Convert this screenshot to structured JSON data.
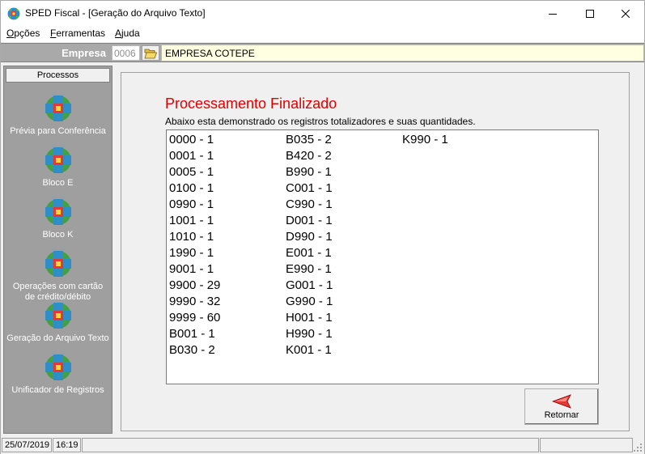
{
  "window": {
    "title": "SPED Fiscal - [Geração do Arquivo Texto]"
  },
  "menu": {
    "items": [
      {
        "label": "Opções",
        "key": "O",
        "rest": "pções"
      },
      {
        "label": "Ferramentas",
        "key": "F",
        "rest": "erramentas"
      },
      {
        "label": "Ajuda",
        "key": "A",
        "rest": "juda"
      }
    ]
  },
  "empresa": {
    "label": "Empresa",
    "code": "0006",
    "name": "EMPRESA COTEPE"
  },
  "sidebar": {
    "header": "Processos",
    "items": [
      {
        "label": "Prévia para Conferência",
        "icon": "globe-icon"
      },
      {
        "label": "Bloco E",
        "icon": "globe-icon"
      },
      {
        "label": "Bloco K",
        "icon": "globe-icon"
      },
      {
        "label": "Operações com cartão de crédito/débito",
        "icon": "globe-icon"
      },
      {
        "label": "Geração do Arquivo Texto",
        "icon": "globe-icon"
      },
      {
        "label": "Unificador de Registros",
        "icon": "globe-icon"
      }
    ]
  },
  "main": {
    "title": "Processamento Finalizado",
    "subtitle": "Abaixo esta demonstrado os registros totalizadores e suas quantidades.",
    "columns": [
      [
        "0000 - 1",
        "0001 - 1",
        "0005 - 1",
        "0100 - 1",
        "0990 - 1",
        "1001 - 1",
        "1010 - 1",
        "1990 - 1",
        "9001 - 1",
        "9900 - 29",
        "9990 - 32",
        "9999 - 60",
        "B001 - 1",
        "B030 - 2"
      ],
      [
        "B035 - 2",
        "B420 - 2",
        "B990 - 1",
        "C001 - 1",
        "C990 - 1",
        "D001 - 1",
        "D990 - 1",
        "E001 - 1",
        "E990 - 1",
        "G001 - 1",
        "G990 - 1",
        "H001 - 1",
        "H990 - 1",
        "K001 - 1"
      ],
      [
        "K990 - 1"
      ]
    ],
    "retornar_label": "Retornar"
  },
  "statusbar": {
    "date": "25/07/2019",
    "time": "16:19"
  },
  "colors": {
    "title_red": "#e00000",
    "sidebar_bg": "#9f9f9f",
    "empresa_bg": "#a9a9a9",
    "empresa_name_bg": "#ffffe1"
  }
}
